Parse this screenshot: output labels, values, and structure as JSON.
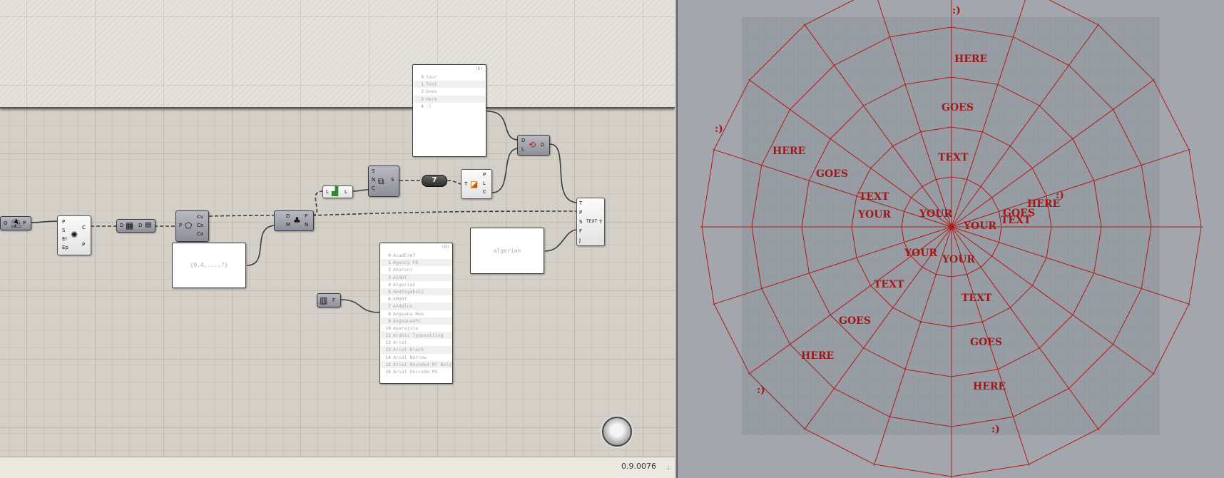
{
  "canvas": {
    "components": {
      "params": {
        "in_label": "O",
        "out_label": "P"
      },
      "polygon": {
        "inputs": [
          "P",
          "S",
          "Er",
          "Ep"
        ],
        "outputs": [
          "C",
          "P"
        ]
      },
      "divide": {
        "in_label": "D",
        "out_label": "D"
      },
      "curve_params": {
        "in_label": "P",
        "outputs": [
          "Cv",
          "Ce",
          "Ca"
        ]
      },
      "deconstruct": {
        "inputs": [
          "D",
          "M"
        ],
        "outputs": [
          "P",
          "N"
        ]
      },
      "list_length": {
        "in_label": "L",
        "out_label": "L"
      },
      "series": {
        "inputs": [
          "S",
          "N",
          "C"
        ],
        "out_label": "S"
      },
      "number": {
        "value": "7"
      },
      "line_eval": {
        "in_label": "T",
        "outputs": [
          "P",
          "L",
          "C"
        ]
      },
      "repeat": {
        "inputs": [
          "D",
          "L"
        ],
        "out_label": "D"
      },
      "text_tag": {
        "inputs": [
          "T",
          "P",
          "S",
          "F",
          "J"
        ],
        "center": "TEXT",
        "out_label": "T"
      },
      "font_picker": {
        "out_label": "F"
      }
    },
    "words_panel": {
      "tag": "(6)",
      "rows": [
        {
          "i": "0",
          "t": "Your"
        },
        {
          "i": "1",
          "t": "Text"
        },
        {
          "i": "2",
          "t": "Goes"
        },
        {
          "i": "3",
          "t": "Here"
        },
        {
          "i": "4",
          "t": ":)"
        }
      ]
    },
    "sequence_panel": {
      "text": "{0,4,...,?}"
    },
    "fonts_panel": {
      "tag": "(0)",
      "rows": [
        {
          "i": "0",
          "t": "AcadEref"
        },
        {
          "i": "1",
          "t": "Agency FB"
        },
        {
          "i": "2",
          "t": "Aharoni"
        },
        {
          "i": "3",
          "t": "AIGDT"
        },
        {
          "i": "4",
          "t": "Algerian"
        },
        {
          "i": "5",
          "t": "AmdtSymbols"
        },
        {
          "i": "6",
          "t": "AMGDT"
        },
        {
          "i": "7",
          "t": "Andalus"
        },
        {
          "i": "8",
          "t": "Angsana New"
        },
        {
          "i": "9",
          "t": "AngsanaUPC"
        },
        {
          "i": "10",
          "t": "Aparajita"
        },
        {
          "i": "11",
          "t": "Arabic Typesetting"
        },
        {
          "i": "12",
          "t": "Arial"
        },
        {
          "i": "13",
          "t": "Arial Black"
        },
        {
          "i": "14",
          "t": "Arial Narrow"
        },
        {
          "i": "15",
          "t": "Arial Rounded MT Bold"
        },
        {
          "i": "16",
          "t": "Arial Unicode MS"
        }
      ]
    },
    "font_panel": {
      "text": "algerian"
    }
  },
  "status": {
    "zoom": "0.9.0076"
  },
  "viewport": {
    "labels": [
      {
        "t": "YOUR"
      },
      {
        "t": "YOUR"
      },
      {
        "t": "YOUR"
      },
      {
        "t": "YOUR"
      },
      {
        "t": "YOUR"
      },
      {
        "t": "TEXT"
      },
      {
        "t": "TEXT"
      },
      {
        "t": "TEXT"
      },
      {
        "t": "TEXT"
      },
      {
        "t": "TEXT"
      },
      {
        "t": "GOES"
      },
      {
        "t": "GOES"
      },
      {
        "t": "GOES"
      },
      {
        "t": "GOES"
      },
      {
        "t": "GOES"
      },
      {
        "t": "HERE"
      },
      {
        "t": "HERE"
      },
      {
        "t": "HERE"
      },
      {
        "t": "HERE"
      },
      {
        "t": "HERE"
      },
      {
        "t": ":)"
      },
      {
        "t": ":)"
      },
      {
        "t": ":)"
      },
      {
        "t": ":)"
      },
      {
        "t": ":)"
      }
    ],
    "colors": {
      "curves": "#b01818",
      "background": "#a3a7ad",
      "grid": "#8f949b"
    }
  }
}
